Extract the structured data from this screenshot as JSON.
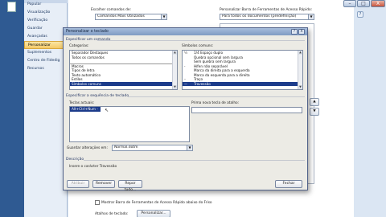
{
  "left_strip": {
    "icon": "document-icon"
  },
  "title_controls": {
    "minimize": "–",
    "maximize": "□",
    "close": "X"
  },
  "help_icon": "?",
  "sidebar": {
    "items": [
      {
        "label": "Popular"
      },
      {
        "label": "Visualização"
      },
      {
        "label": "Verificação"
      },
      {
        "label": "Guardar"
      },
      {
        "label": "Avançadas"
      },
      {
        "label": "Personalizar",
        "active": true
      },
      {
        "label": "Suplementos"
      },
      {
        "label": "Centro de Fidedig"
      },
      {
        "label": "Recursos"
      }
    ]
  },
  "options_main": {
    "choose_commands_label": "Escolher comandos de:",
    "choose_commands_value": "Comandos Mais Utilizados",
    "customize_qat_label": "Personalizar Barra de Ferramentas de Acesso Rápido:",
    "customize_qat_value": "Para todos os documentos (predefinição)",
    "arrow_up": "▲",
    "arrow_down": "▼",
    "show_qat_below_label": "Mostrar Barra de Ferramentas de Acesso Rápido abaixo do Friso",
    "keyboard_shortcuts_label": "Atalhos de teclado:",
    "customize_button": "Personalizar..."
  },
  "dialog": {
    "title": "Personalizar o teclado",
    "help": "?",
    "close": "X",
    "specify_command_label": "Especificar um comando",
    "categories_label": "Categorias:",
    "categories": [
      {
        "label": "Separador Destaques"
      },
      {
        "label": "Todos os comandos"
      },
      {
        "label": ""
      },
      {
        "label": "Macros"
      },
      {
        "label": "Tipos de letra"
      },
      {
        "label": "Texto automático"
      },
      {
        "label": "Estilos"
      },
      {
        "label": "Símbolos comuns",
        "selected": true
      }
    ],
    "common_symbols_label": "Símbolos comuns:",
    "symbols": [
      {
        "sym": "¼",
        "label": "1/4 Espaço duplo"
      },
      {
        "sym": "",
        "label": "Quebra opcional sem largura"
      },
      {
        "sym": "",
        "label": "Sem quebra sem largura"
      },
      {
        "sym": "-",
        "label": "Hífen não separável"
      },
      {
        "sym": "",
        "label": "Marca da direita para a esquerda"
      },
      {
        "sym": "",
        "label": "Marca da esquerda para a direita"
      },
      {
        "sym": "–",
        "label": "Traço"
      },
      {
        "sym": "—",
        "label": "Travessão",
        "selected": true
      }
    ],
    "keyboard_sequence_label": "Especificar a sequência de teclado",
    "current_keys_label": "Teclas actuais:",
    "current_keys": [
      "Alt+Ctrl+Num -"
    ],
    "new_shortcut_label": "Prima nova tecla de atalho:",
    "new_shortcut_value": "",
    "save_changes_label": "Guardar alterações em:",
    "save_changes_value": "Normal.dotm",
    "description_label": "Descrição",
    "description_text": "Insere o carácter Travessão",
    "buttons": {
      "assign": "Atribuir",
      "remove": "Remover",
      "reset_all": "Repor tudo...",
      "close": "Fechar"
    },
    "scroll_up": "▲",
    "scroll_down": "▼",
    "combo_arrow": "▼"
  }
}
